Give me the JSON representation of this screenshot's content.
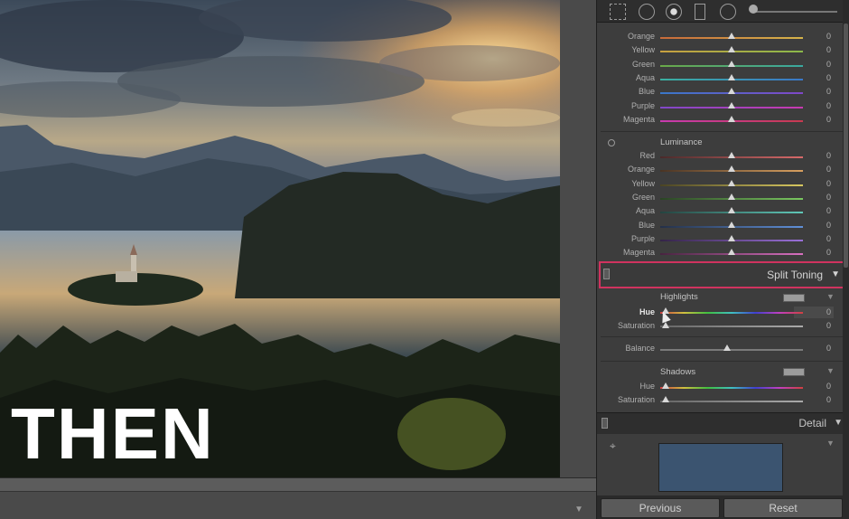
{
  "photo": {
    "overlay_text": "THEN"
  },
  "hsl": {
    "hue_rows": [
      {
        "label": "Orange",
        "value": "0",
        "colors": [
          "#c86a3a",
          "#d6b44a"
        ]
      },
      {
        "label": "Yellow",
        "value": "0",
        "colors": [
          "#c8a040",
          "#8bb84a"
        ]
      },
      {
        "label": "Green",
        "value": "0",
        "colors": [
          "#6aa848",
          "#3aa8a0"
        ]
      },
      {
        "label": "Aqua",
        "value": "0",
        "colors": [
          "#3ab0a0",
          "#3a78c8"
        ]
      },
      {
        "label": "Blue",
        "value": "0",
        "colors": [
          "#3a78c8",
          "#8048c8"
        ]
      },
      {
        "label": "Purple",
        "value": "0",
        "colors": [
          "#8048c8",
          "#c83ab0"
        ]
      },
      {
        "label": "Magenta",
        "value": "0",
        "colors": [
          "#c83ab0",
          "#c83a50"
        ]
      }
    ],
    "luminance_title": "Luminance",
    "luminance_rows": [
      {
        "label": "Red",
        "value": "0",
        "colors": [
          "#4a2a2a",
          "#d86a6a"
        ]
      },
      {
        "label": "Orange",
        "value": "0",
        "colors": [
          "#4a3424",
          "#d8a060"
        ]
      },
      {
        "label": "Yellow",
        "value": "0",
        "colors": [
          "#4a4424",
          "#d8c860"
        ]
      },
      {
        "label": "Green",
        "value": "0",
        "colors": [
          "#2a4424",
          "#7ac860"
        ]
      },
      {
        "label": "Aqua",
        "value": "0",
        "colors": [
          "#244440",
          "#60c8b8"
        ]
      },
      {
        "label": "Blue",
        "value": "0",
        "colors": [
          "#243048",
          "#6090d8"
        ]
      },
      {
        "label": "Purple",
        "value": "0",
        "colors": [
          "#342448",
          "#9a70d8"
        ]
      },
      {
        "label": "Magenta",
        "value": "0",
        "colors": [
          "#482440",
          "#d870c0"
        ]
      }
    ]
  },
  "split_toning": {
    "title": "Split Toning",
    "highlights_label": "Highlights",
    "hue_label": "Hue",
    "hue_value": "0",
    "saturation_label": "Saturation",
    "saturation_value": "0",
    "balance_label": "Balance",
    "balance_value": "0",
    "shadows_label": "Shadows",
    "shadows_hue_label": "Hue",
    "shadows_hue_value": "0",
    "shadows_saturation_label": "Saturation",
    "shadows_saturation_value": "0"
  },
  "detail": {
    "title": "Detail"
  },
  "buttons": {
    "previous": "Previous",
    "reset": "Reset"
  },
  "colors": {
    "highlight_border": "#d0335f"
  }
}
